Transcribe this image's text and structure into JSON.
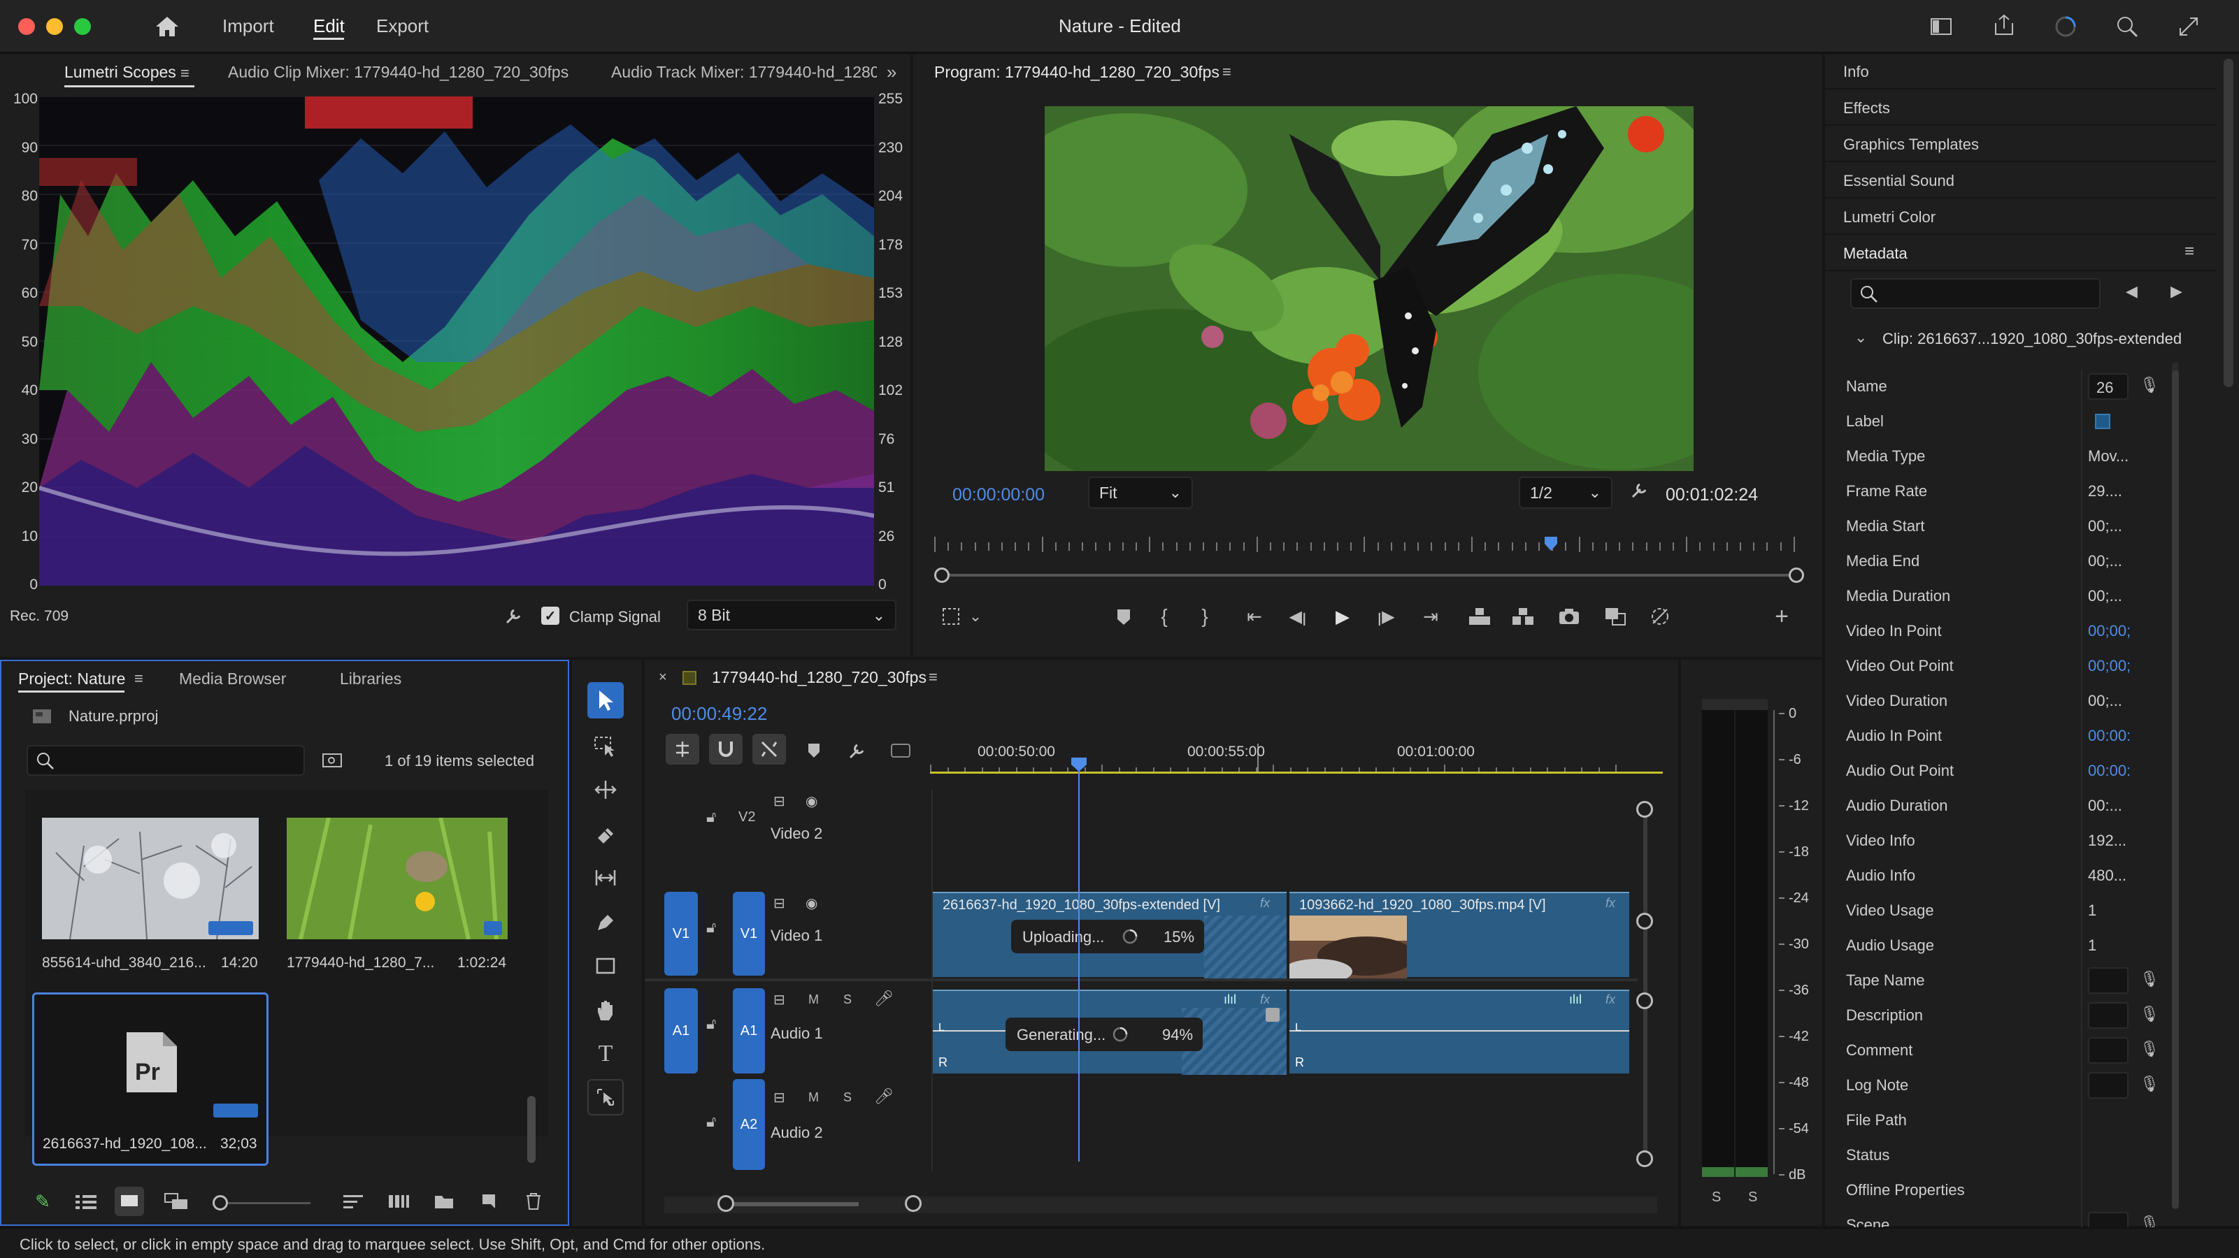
{
  "window": {
    "title": "Nature - Edited",
    "menu": [
      "Import",
      "Edit",
      "Export"
    ],
    "active_menu": "Edit"
  },
  "scopes": {
    "tabs": [
      "Lumetri Scopes",
      "Audio Clip Mixer: 1779440-hd_1280_720_30fps",
      "Audio Track Mixer: 1779440-hd_1280_720_30fps"
    ],
    "left_axis": [
      "100",
      "90",
      "80",
      "70",
      "60",
      "50",
      "40",
      "30",
      "20",
      "10",
      "0"
    ],
    "right_axis": [
      "255",
      "230",
      "204",
      "178",
      "153",
      "128",
      "102",
      "76",
      "51",
      "26",
      "0"
    ],
    "colorspace": "Rec. 709",
    "clamp_label": "Clamp Signal",
    "bit_depth": "8 Bit"
  },
  "program": {
    "title": "Program: 1779440-hd_1280_720_30fps",
    "timecode_current": "00:00:00:00",
    "zoom": "Fit",
    "resolution": "1/2",
    "timecode_duration": "00:01:02:24",
    "playhead_fraction": 0.71
  },
  "right_panels": {
    "items": [
      "Info",
      "Effects",
      "Graphics Templates",
      "Essential Sound",
      "Lumetri Color",
      "Metadata"
    ],
    "clip_label": "Clip:  2616637...1920_1080_30fps-extended",
    "search_placeholder": ""
  },
  "metadata": [
    {
      "label": "Name",
      "value": "26"
    },
    {
      "label": "Label",
      "value": ""
    },
    {
      "label": "Media Type",
      "value": "Mov..."
    },
    {
      "label": "Frame Rate",
      "value": "29...."
    },
    {
      "label": "Media Start",
      "value": "00;..."
    },
    {
      "label": "Media End",
      "value": "00;..."
    },
    {
      "label": "Media Duration",
      "value": "00;..."
    },
    {
      "label": "Video In Point",
      "value": "00;00;"
    },
    {
      "label": "Video Out Point",
      "value": "00;00;"
    },
    {
      "label": "Video Duration",
      "value": "00;..."
    },
    {
      "label": "Audio In Point",
      "value": "00:00:"
    },
    {
      "label": "Audio Out Point",
      "value": "00:00:"
    },
    {
      "label": "Audio Duration",
      "value": "00:..."
    },
    {
      "label": "Video Info",
      "value": "192..."
    },
    {
      "label": "Audio Info",
      "value": "480..."
    },
    {
      "label": "Video Usage",
      "value": "1"
    },
    {
      "label": "Audio Usage",
      "value": "1"
    },
    {
      "label": "Tape Name",
      "value": ""
    },
    {
      "label": "Description",
      "value": ""
    },
    {
      "label": "Comment",
      "value": ""
    },
    {
      "label": "Log Note",
      "value": ""
    },
    {
      "label": "File Path",
      "value": ""
    },
    {
      "label": "Status",
      "value": ""
    },
    {
      "label": "Offline Properties",
      "value": ""
    },
    {
      "label": "Scene",
      "value": ""
    }
  ],
  "project": {
    "tabs": [
      "Project: Nature",
      "Media Browser",
      "Libraries"
    ],
    "file": "Nature.prproj",
    "selection": "1 of 19 items selected",
    "items": [
      {
        "name": "855614-uhd_3840_216...",
        "duration": "14:20"
      },
      {
        "name": "1779440-hd_1280_7...",
        "duration": "1:02:24"
      },
      {
        "name": "2616637-hd_1920_108...",
        "duration": "32;03"
      }
    ]
  },
  "timeline": {
    "title": "1779440-hd_1280_720_30fps",
    "timecode": "00:00:49:22",
    "ruler": [
      "00:00:50:00",
      "00:00:55:00",
      "00:01:00:00"
    ],
    "tracks": {
      "v2": "Video 2",
      "v1": "Video 1",
      "a1": "Audio 1",
      "a2": "Audio 2"
    },
    "clips": {
      "v1_a": "2616637-hd_1920_1080_30fps-extended [V]",
      "v1_b": "1093662-hd_1920_1080_30fps.mp4 [V]"
    },
    "uploading": {
      "label": "Uploading...",
      "percent": "15%"
    },
    "generating": {
      "label": "Generating...",
      "percent": "94%"
    }
  },
  "meter": {
    "scale": [
      "0",
      "-6",
      "-12",
      "-18",
      "-24",
      "-30",
      "-36",
      "-42",
      "-48",
      "-54",
      "dB"
    ],
    "solo": [
      "S",
      "S"
    ]
  },
  "status": "Click to select, or click in empty space and drag to marquee select. Use Shift, Opt, and Cmd for other options.",
  "colors": {
    "accent": "#2d6cc3",
    "timecode_blue": "#4f8de8",
    "clip_blue": "#2a5c84"
  }
}
